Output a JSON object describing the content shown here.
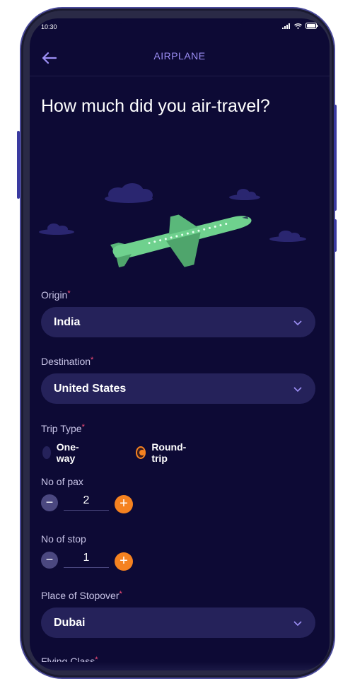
{
  "status": {
    "time": "10:30"
  },
  "appbar": {
    "title": "AIRPLANE"
  },
  "heading": "How much did you air-travel?",
  "origin": {
    "label": "Origin",
    "required_mark": "*",
    "value": "India"
  },
  "destination": {
    "label": "Destination",
    "required_mark": "*",
    "value": "United States"
  },
  "trip_type": {
    "label": "Trip Type",
    "required_mark": "*",
    "options": [
      {
        "label": "One-way",
        "selected": false
      },
      {
        "label": "Round-trip",
        "selected": true
      }
    ]
  },
  "pax": {
    "label": "No of pax",
    "value": "2",
    "minus": "−",
    "plus": "+"
  },
  "stops": {
    "label": "No of stop",
    "value": "1",
    "minus": "−",
    "plus": "+"
  },
  "stopover": {
    "label": "Place of Stopover",
    "required_mark": "*",
    "value": "Dubai"
  },
  "flying_class": {
    "label": "Flying Class",
    "required_mark": "*"
  },
  "colors": {
    "background": "#0d0a35",
    "accent": "#f58220",
    "field": "#25225a",
    "title": "#9d8ff5",
    "plane": "#6fd18e"
  },
  "icons": [
    "back-arrow-icon",
    "chevron-down-icon",
    "signal-icon",
    "wifi-icon",
    "battery-icon"
  ]
}
